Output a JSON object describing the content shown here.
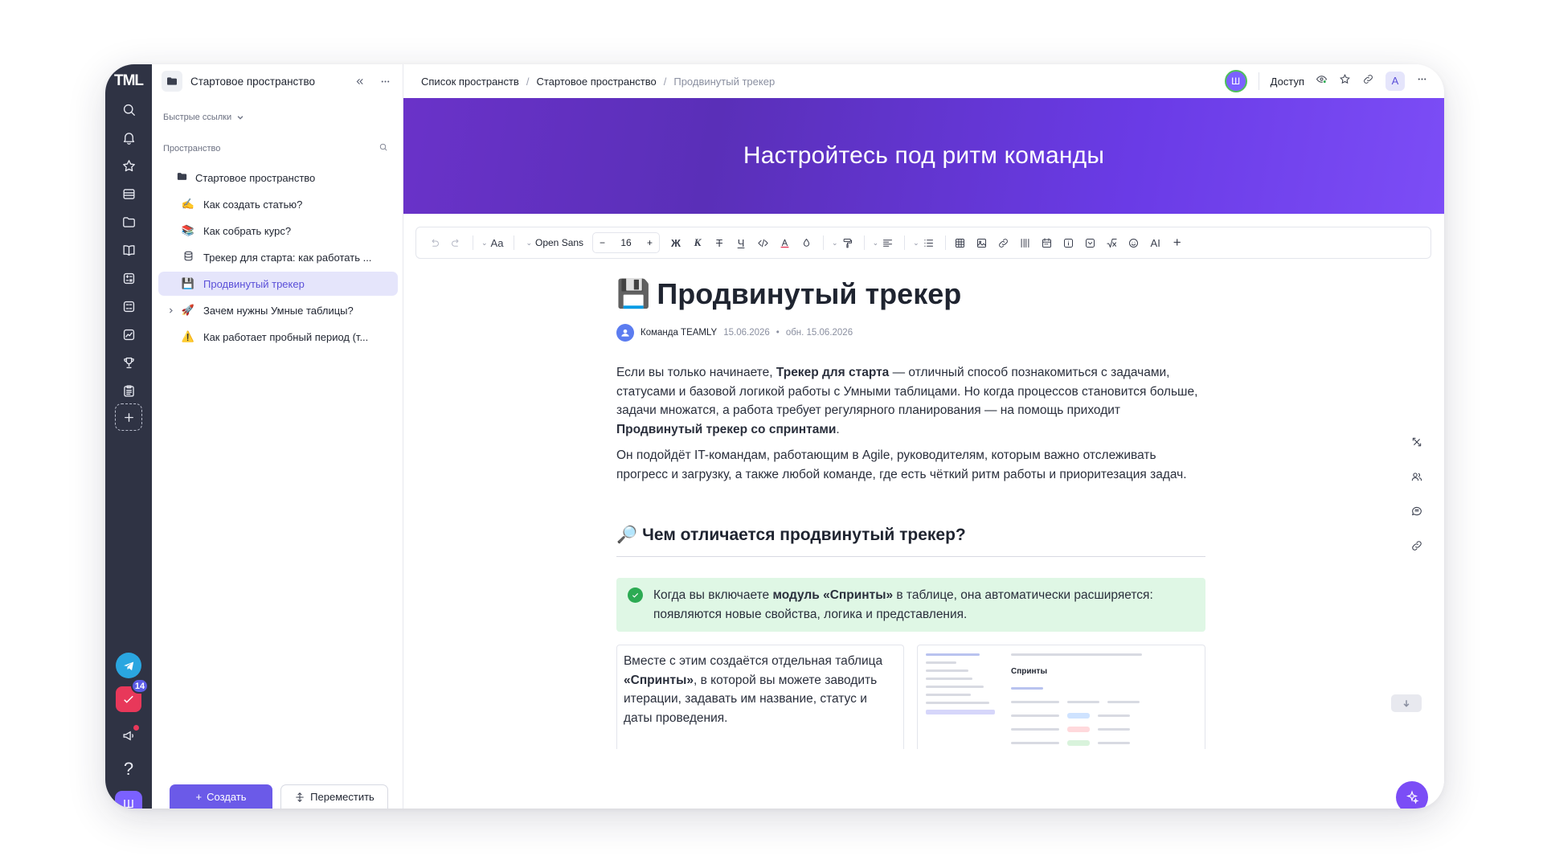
{
  "rail": {
    "logo": "TML",
    "icons": [
      "search-icon",
      "bell-icon",
      "star-icon",
      "archive-icon",
      "folder-icon",
      "book-icon",
      "calculator-icon",
      "grid-icon",
      "chart-icon",
      "trophy-icon",
      "clipboard-icon"
    ],
    "badge_count": "14",
    "help": "?",
    "avatar_letter": "Ш"
  },
  "sidebar": {
    "space_title": "Стартовое пространство",
    "quick_links": "Быстрые ссылки",
    "space_label": "Пространство",
    "tree": [
      {
        "label": "Стартовое пространство",
        "icon": "folder-icon",
        "emoji": ""
      },
      {
        "label": "Как создать статью?",
        "emoji": "✍️"
      },
      {
        "label": "Как собрать курс?",
        "emoji": "📚"
      },
      {
        "label": "Трекер для старта: как работать ...",
        "icon": "database-icon",
        "emoji": ""
      },
      {
        "label": "Продвинутый трекер",
        "emoji": "💾"
      },
      {
        "label": "Зачем нужны Умные таблицы?",
        "emoji": "🚀"
      },
      {
        "label": "Как работает пробный период (т...",
        "emoji": "⚠️"
      }
    ],
    "create_button": "Создать",
    "move_button": "Переместить"
  },
  "topbar": {
    "breadcrumbs": [
      "Список пространств",
      "Стартовое пространство",
      "Продвинутый трекер"
    ],
    "avatar_letter": "Ш",
    "access": "Доступ",
    "ai_chip": "A"
  },
  "banner": {
    "title": "Настройтесь под ритм команды"
  },
  "toolbar": {
    "text_style": "Aa",
    "font": "Open Sans",
    "size": "16",
    "bold": "Ж",
    "italic": "К",
    "strike": "Т",
    "underline": "Ч",
    "ai": "AI",
    "minus": "−",
    "plus": "+",
    "add": "+"
  },
  "document": {
    "emoji": "💾",
    "title": "Продвинутый трекер",
    "author": "Команда TEAMLY",
    "created": "15.06.2026",
    "updated": "обн. 15.06.2026",
    "para1_a": "Если вы только начинаете, ",
    "para1_b": "Трекер для старта",
    "para1_c": " — отличный способ познакомиться с задачами, статусами и базовой логикой работы с Умными таблицами. Но когда процессов становится больше, задачи множатся, а работа требует регулярного планирования — на помощь приходит ",
    "para1_d": "Продвинутый трекер со спринтами",
    "para1_e": ".",
    "para2": "Он подойдёт IT-командам, работающим в Agile, руководителям, которым важно отслеживать прогресс и загрузку, а также любой команде, где есть чёткий ритм работы и приоритезация задач.",
    "h2_emoji": "🔎",
    "h2": "Чем отличается продвинутый трекер?",
    "callout_a": "Когда вы включаете ",
    "callout_b": "модуль «Спринты»",
    "callout_c": " в таблице, она автоматически расширяется: появляются новые свойства, логика и представления.",
    "col_a": "Вместе с этим создаётся отдельная таблица ",
    "col_b": "«Спринты»",
    "col_c": ", в которой вы можете заводить итерации, задавать им название, статус и даты проведения.",
    "preview_title": "Спринты"
  },
  "colors": {
    "rail": "#2f3344",
    "accent": "#6b5ae8",
    "active_item": "#e5e5fb",
    "callout": "#dff7e5",
    "banner_start": "#6a32c9",
    "banner_end": "#7c4df6"
  }
}
